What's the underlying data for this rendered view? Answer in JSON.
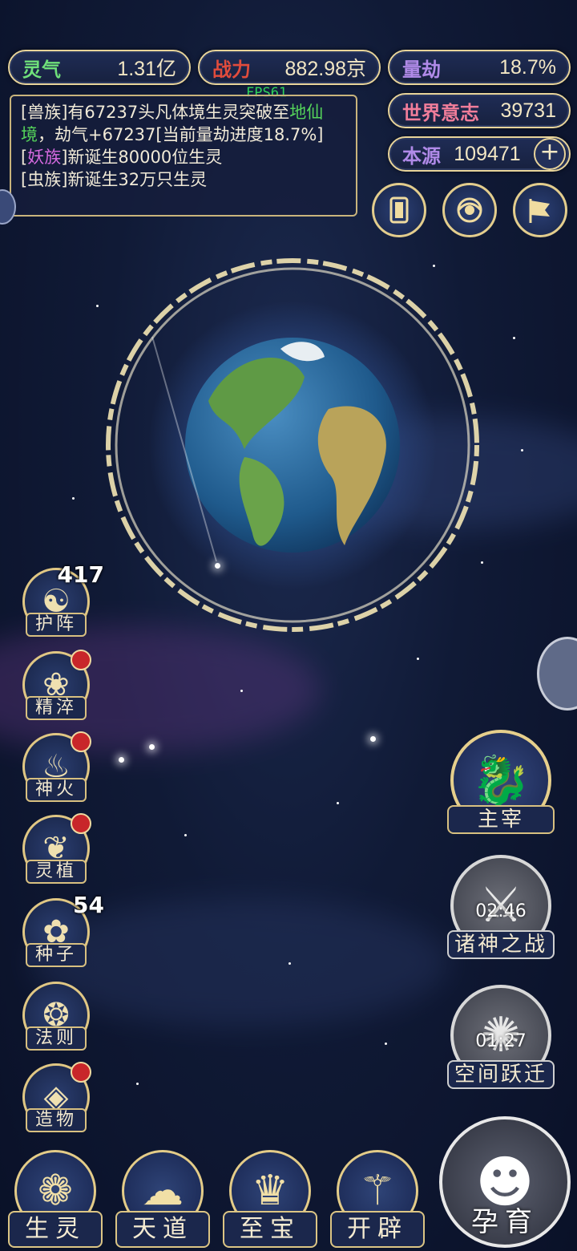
{
  "stats": {
    "lingqi": {
      "label": "灵气",
      "value": "1.31亿",
      "label_color": "#6fe07a"
    },
    "zhanli": {
      "label": "战力",
      "value": "882.98京",
      "label_color": "#e14c3c"
    },
    "liangjie": {
      "label": "量劫",
      "value": "18.7%",
      "label_color": "#b08ae8"
    },
    "shijie": {
      "label": "世界意志",
      "value": "39731",
      "label_color": "#f07d9a"
    },
    "benyuan": {
      "label": "本源",
      "value": "109471",
      "label_color": "#b08ae8",
      "plus": "+"
    }
  },
  "fps": "FPS61",
  "log": {
    "line1": {
      "prefix": "[兽族]有67237头凡体境生灵突破至",
      "highlight": "地仙境",
      "suffix": "，劫气+67237[当前量劫进度18.7%]"
    },
    "line2": {
      "open": "[",
      "tag": "妖族",
      "text": "]新诞生80000位生灵"
    },
    "line3": {
      "text": "[虫族]新诞生32万只生灵"
    }
  },
  "top_buttons": [
    {
      "icon": "card-icon"
    },
    {
      "icon": "swirl-icon"
    },
    {
      "icon": "flag-icon"
    }
  ],
  "side_menu": [
    {
      "label": "护阵",
      "icon": "yinyang-icon",
      "badge": "417",
      "red_dot": false
    },
    {
      "label": "精淬",
      "icon": "flame-lotus-icon",
      "badge": "",
      "red_dot": true
    },
    {
      "label": "神火",
      "icon": "fire-icon",
      "badge": "",
      "red_dot": true
    },
    {
      "label": "灵植",
      "icon": "leaf-icon",
      "badge": "",
      "red_dot": true
    },
    {
      "label": "种子",
      "icon": "seed-icon",
      "badge": "54",
      "red_dot": false
    },
    {
      "label": "法则",
      "icon": "rune-icon",
      "badge": "",
      "red_dot": false
    },
    {
      "label": "造物",
      "icon": "crystal-icon",
      "badge": "",
      "red_dot": true
    }
  ],
  "right_menu": [
    {
      "label": "主宰",
      "icon": "dragon-icon",
      "timer": ""
    },
    {
      "label": "诸神之战",
      "icon": "sword-icon",
      "timer": "02:46"
    },
    {
      "label": "空间跃迁",
      "icon": "vortex-icon",
      "timer": "01:27"
    }
  ],
  "bottom_bar": [
    {
      "label": "生灵",
      "icon": "phoenix-icon"
    },
    {
      "label": "天道",
      "icon": "cloud-icon"
    },
    {
      "label": "至宝",
      "icon": "treasure-icon"
    },
    {
      "label": "开辟",
      "icon": "spear-icon"
    }
  ],
  "incubate": {
    "label": "孕育",
    "icon": "embryo-icon"
  }
}
